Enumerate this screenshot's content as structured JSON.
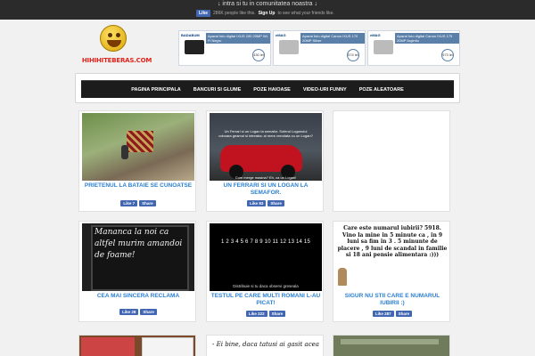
{
  "topbar": {
    "invite": "↓ intra si tu in comunitatea noastra ↓",
    "fb_like": "Like",
    "fb_count_text": "286K people like this.",
    "fb_signup": "Sign Up",
    "fb_tail": "to see what your friends like."
  },
  "logo": {
    "text": "HIHIHITEBERAS.COM"
  },
  "ads": [
    {
      "brand": "BADABUM",
      "headline": "Aparat foto digital IXUS 190 20MP Wi-Fi Negru",
      "price": "430 lei",
      "camera": "black"
    },
    {
      "brand": "eMAG",
      "headline": "Aparat foto digital Canon IXUS 170 20MP Silver",
      "price": "574 lei",
      "camera": "silver"
    },
    {
      "brand": "eMAG",
      "headline": "Aparat foto digital Canon IXUS 175 20MP Argintiu",
      "price": "573 lei",
      "camera": "silver"
    }
  ],
  "nav": {
    "items": [
      "PAGINA PRINCIPALA",
      "BANCURI SI GLUME",
      "POZE HAIOASE",
      "VIDEO-URI FUNNY",
      "POZE ALEATOARE"
    ]
  },
  "posts": [
    {
      "title": "PRIETENUL LA BATAIE SE CUNOATSE",
      "likes": "Like 7",
      "share": "Share"
    },
    {
      "title": "UN FERRARI SI UN LOGAN LA SEMAFOR.",
      "likes": "Like 83",
      "share": "Share",
      "caption_top": "Un Ferrari si un Logan la semafor. Soferul Loganului coboara geamul si intreaba: ai mers vreodata cu un Logan?",
      "caption_bottom": "Cum merge masina? Eh, ca un Logan!"
    },
    {
      "title": "",
      "likes": "",
      "share": ""
    },
    {
      "title": "CEA MAI SINCERA RECLAMA",
      "likes": "Like 28",
      "share": "Share",
      "board_text": "Mananca la noi ca altfel murim amandoi de foame!"
    },
    {
      "title": "TESTUL PE CARE MULTI ROMANI L-AU PICAT!",
      "likes": "Like 222",
      "share": "Share",
      "numbers": "1 2 3 4 5 6 7 8 9 10 11 12 13 14 15",
      "caption": "Distribuie si tu daca observi greseala"
    },
    {
      "title": "SIGUR NU STII CARE E NUMARUL IUBIRII :)",
      "likes": "Like 287",
      "share": "Share",
      "text": "Care este numarul iubirii? 5918. Vino la mine in 5 minute ca , in 9 luni sa fim in 3 . 5 minunte de placere , 9 luni de scandal in familie si 18 ani pensie alimentara :)))"
    }
  ],
  "row3": [
    {
      "text": ""
    },
    {
      "text": "- Ei bine, daca tatusi ai gasit acea"
    },
    {
      "text": ""
    }
  ]
}
